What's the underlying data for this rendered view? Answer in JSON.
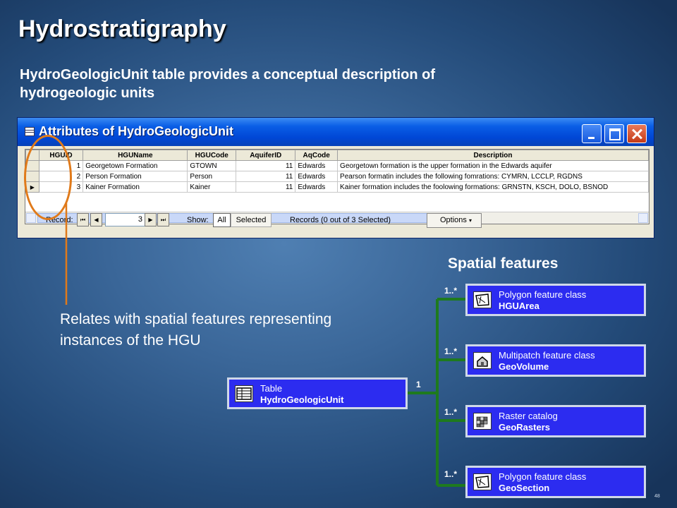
{
  "slide": {
    "title": "Hydrostratigraphy",
    "subtitle": "HydroGeologicUnit table provides a conceptual description of hydrogeologic units",
    "relates_text": "Relates with spatial features representing instances of the HGU",
    "spatial_heading": "Spatial features",
    "page_number": "48"
  },
  "window": {
    "title": "Attributes of HydroGeologicUnit",
    "columns": [
      "HGUID",
      "HGUName",
      "HGUCode",
      "AquiferID",
      "AqCode",
      "Description"
    ],
    "rows": [
      {
        "selector": "",
        "HGUID": "1",
        "HGUName": "Georgetown Formation",
        "HGUCode": "GTOWN",
        "AquiferID": "11",
        "AqCode": "Edwards",
        "Description": "Georgetown formation is the upper formation in the Edwards aquifer"
      },
      {
        "selector": "",
        "HGUID": "2",
        "HGUName": "Person Formation",
        "HGUCode": "Person",
        "AquiferID": "11",
        "AqCode": "Edwards",
        "Description": "Pearson formatin includes the following fomrations: CYMRN, LCCLP, RGDNS"
      },
      {
        "selector": "▶",
        "HGUID": "3",
        "HGUName": "Kainer Formation",
        "HGUCode": "Kainer",
        "AquiferID": "11",
        "AqCode": "Edwards",
        "Description": "Kainer formation includes the foolowing formations: GRNSTN, KSCH, DOLO, BSNOD"
      }
    ],
    "record_label": "Record:",
    "record_value": "3",
    "show_label": "Show:",
    "show_all": "All",
    "show_selected": "Selected",
    "records_status": "Records (0 out of 3 Selected)",
    "options_label": "Options"
  },
  "diagram": {
    "table_box": {
      "line1": "Table",
      "line2": "HydroGeologicUnit"
    },
    "one_label": "1",
    "many_label": "1..*",
    "features": [
      {
        "line1": "Polygon feature class",
        "line2": "HGUArea",
        "icon": "polygon-icon"
      },
      {
        "line1": "Multipatch feature class",
        "line2": "GeoVolume",
        "icon": "multipatch-icon"
      },
      {
        "line1": "Raster catalog",
        "line2": "GeoRasters",
        "icon": "raster-icon"
      },
      {
        "line1": "Polygon feature class",
        "line2": "GeoSection",
        "icon": "polygon-icon"
      }
    ]
  },
  "colors": {
    "box_fill": "#2c2cf0",
    "connector": "#1e7a1e",
    "highlight_oval": "#e07a1a"
  }
}
